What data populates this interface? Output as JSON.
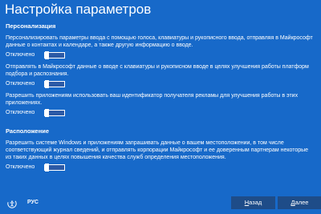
{
  "page": {
    "title": "Настройка параметров"
  },
  "personalization": {
    "heading": "Персонализация",
    "settings": [
      {
        "description": "Персонализировать параметры ввода с помощью голоса, клавиатуры и рукописного ввода, отправляя в Майкрософт данные о контактах и календаре, а также другую информацию о вводе.",
        "state": "Отключено",
        "on": false
      },
      {
        "description": "Отправлять в Майкрософт данные о вводе с клавиатуры и рукописном вводе в целях улучшения работы платформ подбора и распознания.",
        "state": "Отключено",
        "on": false
      },
      {
        "description": "Разрешить приложениям использовать ваш идентификатор получателя рекламы для улучшения работы в этих приложениях.",
        "state": "Отключено",
        "on": false
      }
    ]
  },
  "location": {
    "heading": "Расположение",
    "settings": [
      {
        "description": "Разрешить системе Windows и приложениям запрашивать данные о вашем местоположении, в том числе соответствующий журнал сведений, и отправлять корпорации Майкрософт и ее доверенным партнерам некоторые из таких данных в целях повышения качества служб определения местоположения.",
        "state": "Отключено",
        "on": false
      }
    ]
  },
  "bottom_bar": {
    "ease_of_access_icon": "ease-of-access-icon",
    "language": "РУС",
    "back_accel": "Н",
    "back_rest": "азад",
    "next_accel": "Д",
    "next_rest": "алее"
  },
  "colors": {
    "background": "#1769c9",
    "button": "#1e4c88",
    "toggle_track": "#2c5aa6",
    "text": "#ffffff"
  }
}
